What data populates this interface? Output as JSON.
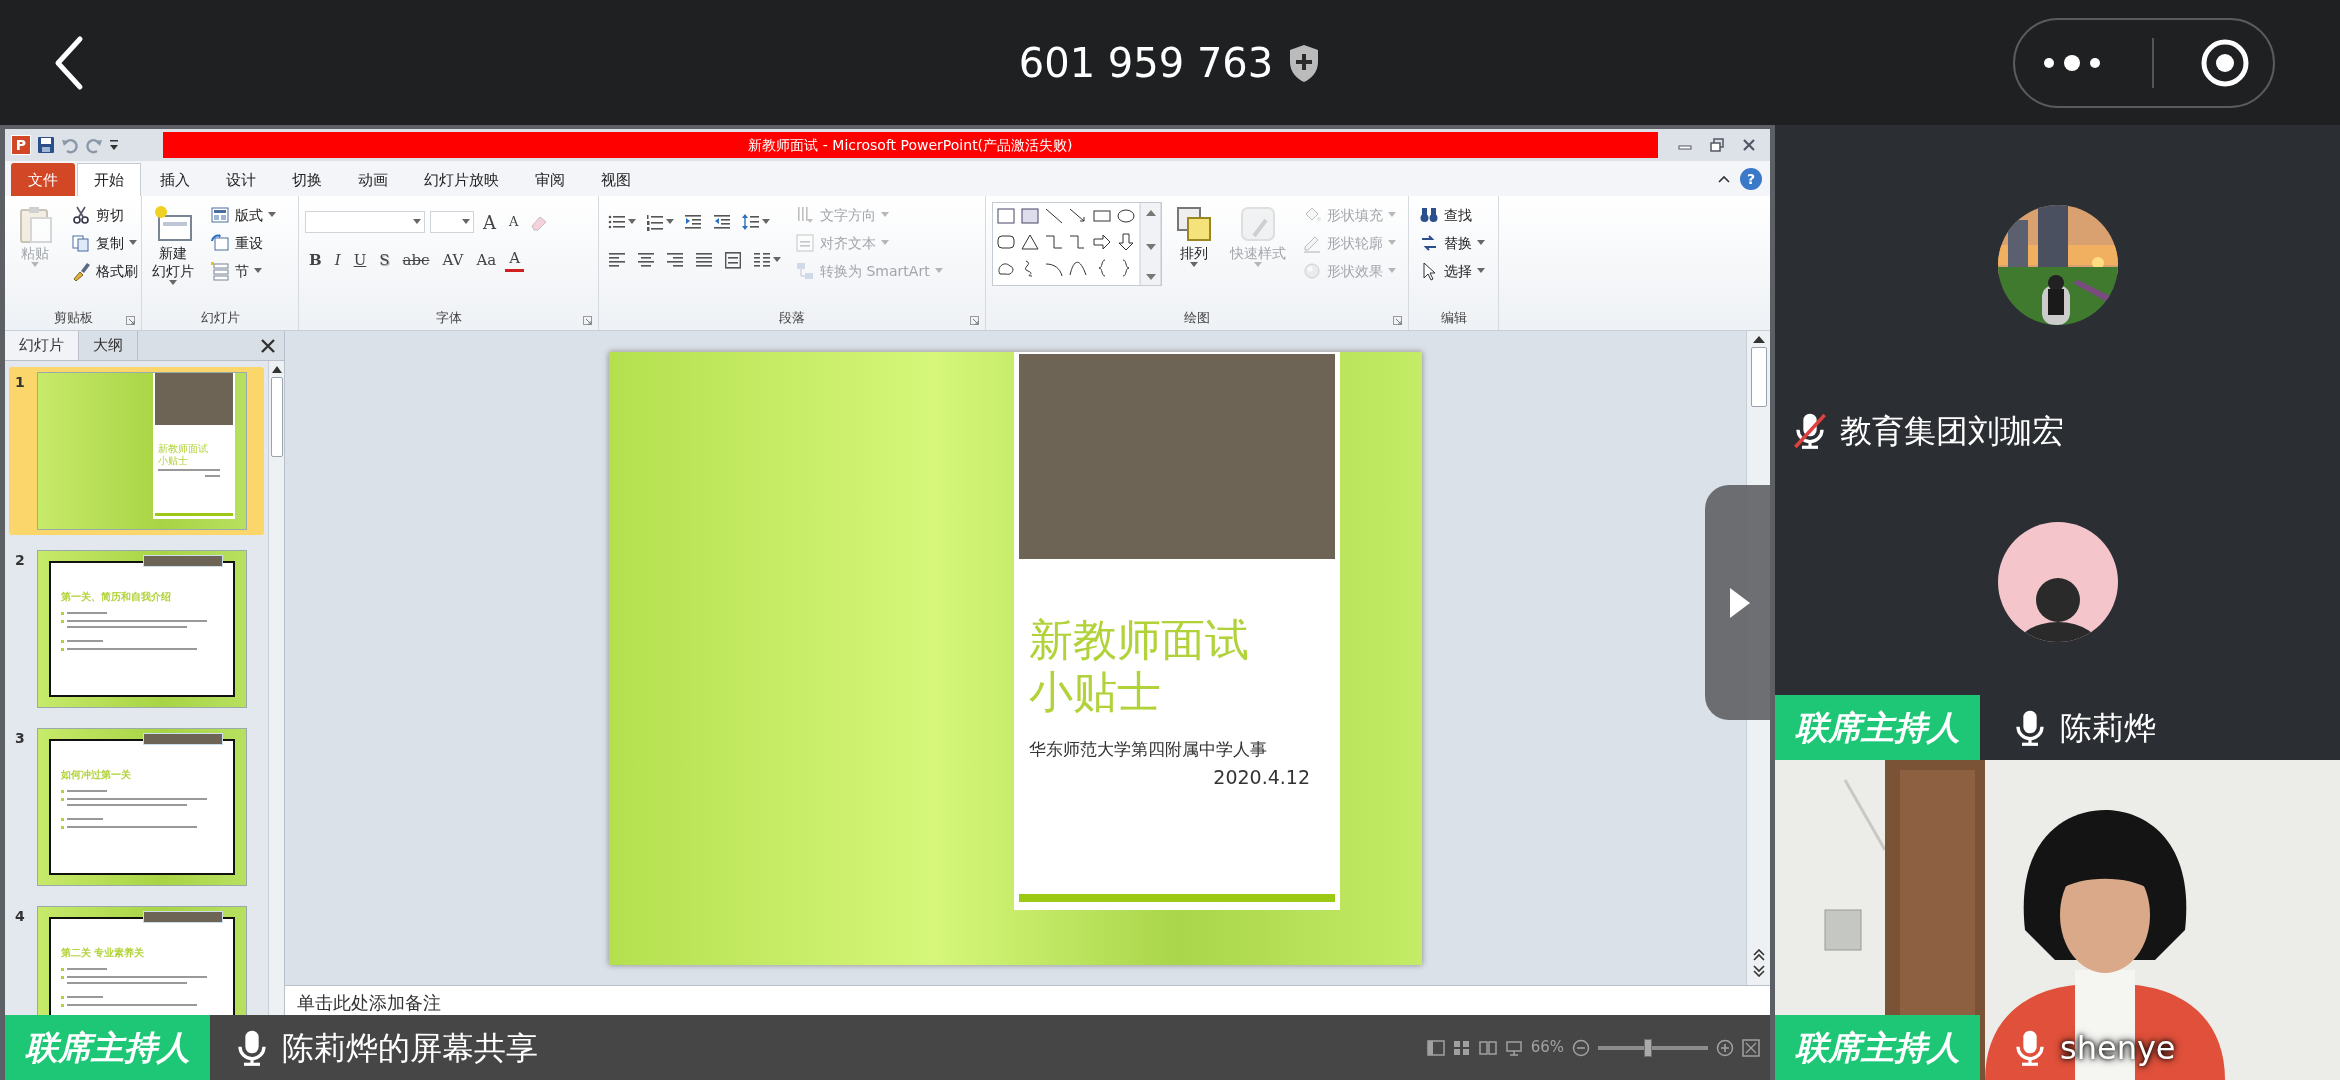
{
  "top_bar": {
    "meeting_id": "601 959 763"
  },
  "powerpoint": {
    "app_letter": "P",
    "title": "新教师面试 - Microsoft PowerPoint(产品激活失败)",
    "help_label": "?",
    "tabs": [
      {
        "label": "文件",
        "kind": "file",
        "selected": false
      },
      {
        "label": "开始",
        "kind": "tab",
        "selected": true
      },
      {
        "label": "插入",
        "kind": "tab",
        "selected": false
      },
      {
        "label": "设计",
        "kind": "tab",
        "selected": false
      },
      {
        "label": "切换",
        "kind": "tab",
        "selected": false
      },
      {
        "label": "动画",
        "kind": "tab",
        "selected": false
      },
      {
        "label": "幻灯片放映",
        "kind": "tab",
        "selected": false
      },
      {
        "label": "审阅",
        "kind": "tab",
        "selected": false
      },
      {
        "label": "视图",
        "kind": "tab",
        "selected": false
      }
    ],
    "ribbon_groups": [
      {
        "label": "剪贴板",
        "launcher": true,
        "sections": [
          {
            "kind": "large",
            "label_lines": [
              "粘贴"
            ],
            "disabled": true,
            "dropdown": true
          },
          {
            "kind": "stack",
            "items": [
              {
                "label": "剪切",
                "disabled": false,
                "dropdown": false
              },
              {
                "label": "复制",
                "disabled": false,
                "dropdown": true
              },
              {
                "label": "格式刷",
                "disabled": false,
                "dropdown": false
              }
            ]
          }
        ]
      },
      {
        "label": "幻灯片",
        "launcher": false,
        "sections": [
          {
            "kind": "large",
            "label_lines": [
              "新建",
              "幻灯片"
            ],
            "disabled": false,
            "dropdown": true
          },
          {
            "kind": "stack",
            "items": [
              {
                "label": "版式",
                "disabled": false,
                "dropdown": true
              },
              {
                "label": "重设",
                "disabled": false,
                "dropdown": false
              },
              {
                "label": "节",
                "disabled": false,
                "dropdown": true
              }
            ]
          }
        ]
      },
      {
        "label": "字体",
        "launcher": true,
        "sections": [
          {
            "kind": "toolbar",
            "lines": [
              {
                "items": [
                  {
                    "kind": "field"
                  },
                  {
                    "kind": "field"
                  },
                  {
                    "kind": "glyph",
                    "label": "A"
                  },
                  {
                    "kind": "glyph",
                    "label": "A"
                  },
                  {
                    "kind": "icon",
                    "disabled": true,
                    "dropdown": false
                  }
                ]
              },
              {
                "items": [
                  {
                    "kind": "glyph",
                    "label": "B"
                  },
                  {
                    "kind": "glyph",
                    "label": "I"
                  },
                  {
                    "kind": "glyph",
                    "label": "U"
                  },
                  {
                    "kind": "glyph",
                    "label": "S"
                  },
                  {
                    "kind": "glyph",
                    "label": "abc"
                  },
                  {
                    "kind": "glyph",
                    "label": "AV"
                  },
                  {
                    "kind": "glyph",
                    "label": "Aa"
                  },
                  {
                    "kind": "glyph",
                    "label": "A"
                  }
                ]
              }
            ]
          }
        ]
      },
      {
        "label": "段落",
        "launcher": true,
        "sections": [
          {
            "kind": "toolbar",
            "lines": [
              {
                "items": [
                  {
                    "kind": "icon",
                    "disabled": false,
                    "dropdown": true
                  },
                  {
                    "kind": "icon",
                    "disabled": false,
                    "dropdown": true
                  },
                  {
                    "kind": "icon",
                    "disabled": false,
                    "dropdown": false
                  },
                  {
                    "kind": "icon",
                    "disabled": false,
                    "dropdown": false
                  },
                  {
                    "kind": "icon",
                    "disabled": false,
                    "dropdown": true
                  }
                ]
              },
              {
                "items": [
                  {
                    "kind": "icon",
                    "disabled": false,
                    "dropdown": false
                  },
                  {
                    "kind": "icon",
                    "disabled": false,
                    "dropdown": false
                  },
                  {
                    "kind": "icon",
                    "disabled": false,
                    "dropdown": false
                  },
                  {
                    "kind": "icon",
                    "disabled": false,
                    "dropdown": false
                  },
                  {
                    "kind": "icon",
                    "disabled": false,
                    "dropdown": false
                  },
                  {
                    "kind": "icon",
                    "disabled": false,
                    "dropdown": true
                  }
                ]
              }
            ]
          },
          {
            "kind": "stack",
            "items": [
              {
                "label": "文字方向",
                "disabled": true,
                "dropdown": true
              },
              {
                "label": "对齐文本",
                "disabled": true,
                "dropdown": true
              },
              {
                "label": "转换为 SmartArt",
                "disabled": true,
                "dropdown": true
              }
            ]
          }
        ]
      },
      {
        "label": "绘图",
        "launcher": true,
        "sections": [
          {
            "kind": "gallery"
          },
          {
            "kind": "large",
            "label_lines": [
              "排列"
            ],
            "disabled": false,
            "dropdown": true
          },
          {
            "kind": "large",
            "label_lines": [
              "快速样式"
            ],
            "disabled": true,
            "dropdown": true
          },
          {
            "kind": "stack",
            "items": [
              {
                "label": "形状填充",
                "disabled": true,
                "dropdown": true
              },
              {
                "label": "形状轮廓",
                "disabled": true,
                "dropdown": true
              },
              {
                "label": "形状效果",
                "disabled": true,
                "dropdown": true
              }
            ]
          }
        ]
      },
      {
        "label": "编辑",
        "launcher": false,
        "sections": [
          {
            "kind": "stack",
            "items": [
              {
                "label": "查找",
                "disabled": false,
                "dropdown": false
              },
              {
                "label": "替换",
                "disabled": false,
                "dropdown": true
              },
              {
                "label": "选择",
                "disabled": false,
                "dropdown": true
              }
            ]
          }
        ]
      }
    ],
    "slide_panel": {
      "tabs": [
        {
          "label": "幻灯片",
          "selected": true
        },
        {
          "label": "大纲",
          "selected": false
        }
      ],
      "thumbnails": [
        {
          "number": "1",
          "kind": "title",
          "title_lines": [
            "新教师面试",
            "小贴士"
          ],
          "selected": true
        },
        {
          "number": "2",
          "kind": "content",
          "title_lines": [
            "第一关、简历和自我介绍"
          ],
          "selected": false
        },
        {
          "number": "3",
          "kind": "content",
          "title_lines": [
            "如何冲过第一关"
          ],
          "selected": false
        },
        {
          "number": "4",
          "kind": "content",
          "title_lines": [
            "第二关 专业素养关"
          ],
          "selected": false
        }
      ]
    },
    "slide": {
      "title_lines": [
        "新教师面试",
        "小贴士"
      ],
      "subtitle": "华东师范大学第四附属中学人事",
      "date": "2020.4.12"
    },
    "notes_placeholder": "单击此处添加备注",
    "zoom_label": "66%",
    "zoom_slider": {
      "level": 0.45
    }
  },
  "share_bar": {
    "role": "联席主持人",
    "muted": false,
    "text": "陈莉烨的屏幕共享"
  },
  "participants": [
    {
      "name": "教育集团刘珈宏",
      "muted": true
    },
    {
      "kind": "avatar",
      "name": "陈莉烨",
      "role": "联席主持人",
      "muted": false
    },
    {
      "kind": "video",
      "name": "shenye",
      "role": "联席主持人",
      "muted": false
    }
  ]
}
